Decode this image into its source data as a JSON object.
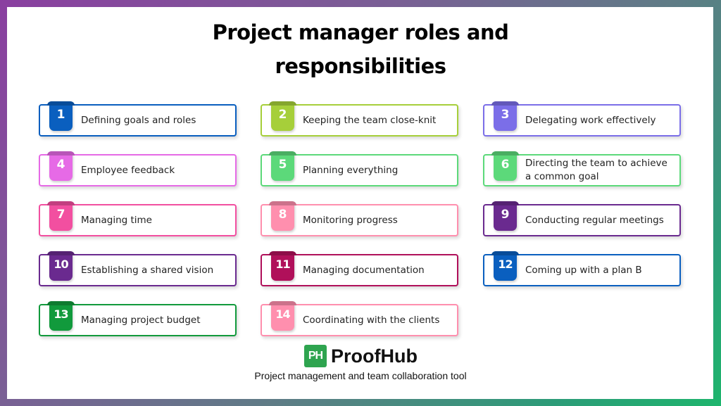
{
  "title": {
    "line1": "Project manager roles and",
    "line2": "responsibilities"
  },
  "items": [
    {
      "number": "1",
      "label": "Defining goals and roles",
      "color": "#0a5fbf"
    },
    {
      "number": "2",
      "label": "Keeping the team close-knit",
      "color": "#a6cf3a"
    },
    {
      "number": "3",
      "label": "Delegating work effectively",
      "color": "#7b6ee8"
    },
    {
      "number": "4",
      "label": "Employee feedback",
      "color": "#e66ae6"
    },
    {
      "number": "5",
      "label": "Planning everything",
      "color": "#5cd97a"
    },
    {
      "number": "6",
      "label": "Directing the team to achieve a common goal",
      "color": "#5cd97a"
    },
    {
      "number": "7",
      "label": "Managing time",
      "color": "#f24fa0"
    },
    {
      "number": "8",
      "label": "Monitoring progress",
      "color": "#ff8fae"
    },
    {
      "number": "9",
      "label": "Conducting regular meetings",
      "color": "#6a2a8f"
    },
    {
      "number": "10",
      "label": "Establishing a shared vision",
      "color": "#6a2a8f"
    },
    {
      "number": "11",
      "label": "Managing documentation",
      "color": "#b0105a"
    },
    {
      "number": "12",
      "label": "Coming up with a plan B",
      "color": "#0a5fbf"
    },
    {
      "number": "13",
      "label": "Managing project budget",
      "color": "#119a3c"
    },
    {
      "number": "14",
      "label": "Coordinating with the clients",
      "color": "#ff8fae"
    }
  ],
  "footer": {
    "logo_badge": "PH",
    "brand": "ProofHub",
    "tagline": "Project management and team collaboration tool",
    "brand_color": "#2ea44f"
  },
  "frame_colors": {
    "start": "#8a3fa0",
    "end": "#1eb56d"
  }
}
